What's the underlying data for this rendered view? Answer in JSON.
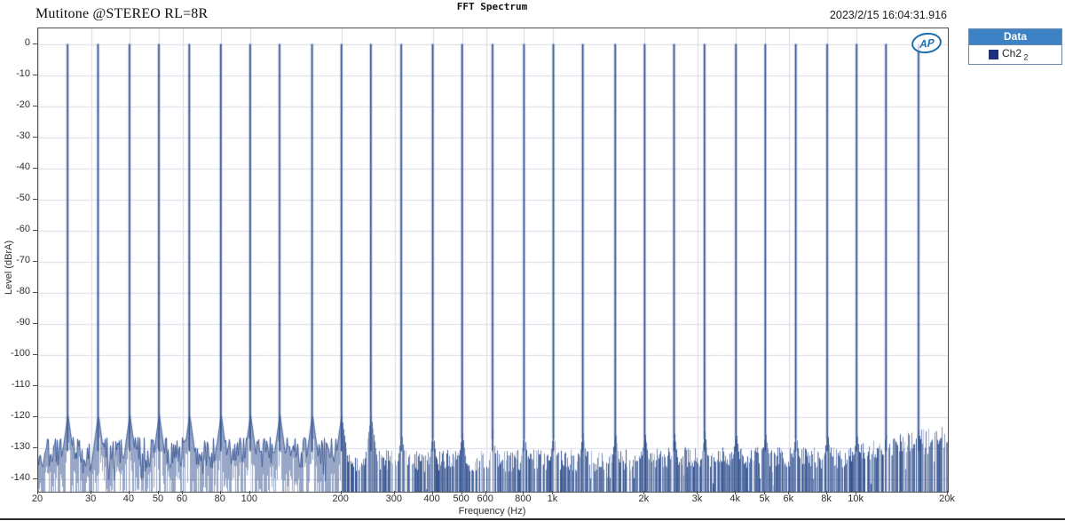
{
  "header": {
    "title": "FFT Spectrum",
    "annotation": "Mutitone @STEREO RL=8R",
    "timestamp": "2023/2/15 16:04:31.916"
  },
  "logo": {
    "text": "AP",
    "color": "#1a6dad"
  },
  "legend": {
    "header_label": "Data",
    "header_bg": "#3d82c4",
    "entry": {
      "label": "Ch2",
      "sub": "2",
      "swatch_color": "#1b2f7e"
    }
  },
  "chart_data": {
    "type": "line",
    "title": "FFT Spectrum",
    "xlabel": "Frequency (Hz)",
    "ylabel": "Level (dBrA)",
    "x_scale": "log",
    "xlim": [
      20,
      20000
    ],
    "ylim": [
      -144,
      5
    ],
    "grid": true,
    "grid_color": "#d9dde5",
    "border_color": "#4d4d4d",
    "y_ticks": [
      0,
      -10,
      -20,
      -30,
      -40,
      -50,
      -60,
      -70,
      -80,
      -90,
      -100,
      -110,
      -120,
      -130,
      -140
    ],
    "x_ticks": [
      {
        "f": 20,
        "label": "20"
      },
      {
        "f": 30,
        "label": "30"
      },
      {
        "f": 40,
        "label": "40"
      },
      {
        "f": 50,
        "label": "50"
      },
      {
        "f": 60,
        "label": "60"
      },
      {
        "f": 80,
        "label": "80"
      },
      {
        "f": 100,
        "label": "100"
      },
      {
        "f": 200,
        "label": "200"
      },
      {
        "f": 300,
        "label": "300"
      },
      {
        "f": 400,
        "label": "400"
      },
      {
        "f": 500,
        "label": "500"
      },
      {
        "f": 600,
        "label": "600"
      },
      {
        "f": 800,
        "label": "800"
      },
      {
        "f": 1000,
        "label": "1k"
      },
      {
        "f": 2000,
        "label": "2k"
      },
      {
        "f": 3000,
        "label": "3k"
      },
      {
        "f": 4000,
        "label": "4k"
      },
      {
        "f": 5000,
        "label": "5k"
      },
      {
        "f": 6000,
        "label": "6k"
      },
      {
        "f": 8000,
        "label": "8k"
      },
      {
        "f": 10000,
        "label": "10k"
      },
      {
        "f": 20000,
        "label": "20k"
      }
    ],
    "series": [
      {
        "name": "Ch2",
        "color": "#31508f",
        "halo_color": "#7a8fbc",
        "tone_level_db": 0,
        "tones_hz": [
          25,
          31.5,
          40,
          50,
          63,
          80,
          100,
          125,
          160,
          200,
          250,
          315,
          400,
          500,
          630,
          800,
          1000,
          1250,
          1600,
          2000,
          2500,
          3150,
          4000,
          5000,
          6300,
          8000,
          10000,
          12500,
          16000
        ],
        "noise_floor_db": {
          "low_freq_mean": -131.5,
          "mid_freq_mean": -134,
          "high_freq_mean": -133,
          "right_edge_mean": -125,
          "jitter_db": 5,
          "tone_skirt_peak_db": -119
        }
      }
    ]
  }
}
